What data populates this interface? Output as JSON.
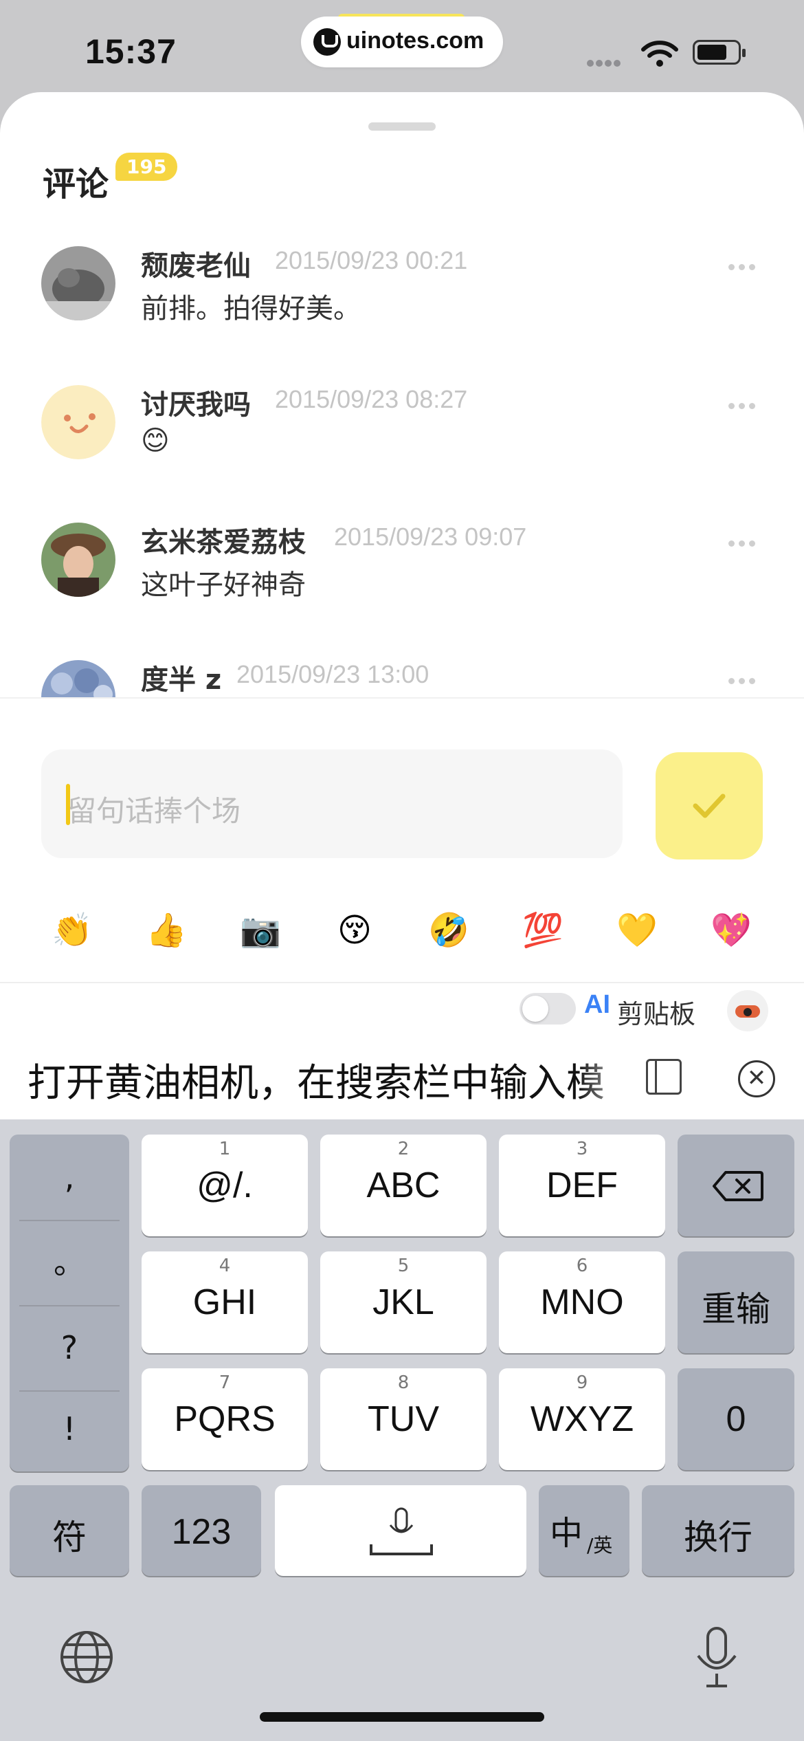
{
  "status_bar": {
    "time": "15:37",
    "url": "uinotes.com"
  },
  "comments_header": {
    "title": "评论",
    "count": "195"
  },
  "comments": [
    {
      "name": "颓废老仙",
      "time": "2015/09/23 00:21",
      "text": "前排。拍得好美。"
    },
    {
      "name": "讨厌我吗",
      "time": "2015/09/23 08:27",
      "text": "😊"
    },
    {
      "name": "玄米茶爱荔枝",
      "time": "2015/09/23 09:07",
      "text": "这叶子好神奇"
    },
    {
      "name": "度半 z",
      "time": "2015/09/23 13:00",
      "text": ""
    }
  ],
  "input": {
    "placeholder": "留句话捧个场"
  },
  "emojis": [
    "👏",
    "👍",
    "📷",
    "😚",
    "🤣",
    "💯",
    "💛",
    "💖"
  ],
  "clipboard_bar": {
    "ai": "AI",
    "label": "剪贴板"
  },
  "suggestion": {
    "text": "打开黄油相机，在搜索栏中输入模"
  },
  "keyboard": {
    "punct": [
      ",",
      "。",
      "?",
      "!"
    ],
    "keys": [
      {
        "num": "1",
        "label": "@/."
      },
      {
        "num": "2",
        "label": "ABC"
      },
      {
        "num": "3",
        "label": "DEF"
      },
      {
        "num": "4",
        "label": "GHI"
      },
      {
        "num": "5",
        "label": "JKL"
      },
      {
        "num": "6",
        "label": "MNO"
      },
      {
        "num": "7",
        "label": "PQRS"
      },
      {
        "num": "8",
        "label": "TUV"
      },
      {
        "num": "9",
        "label": "WXYZ"
      }
    ],
    "retype": "重输",
    "zero": "0",
    "symbols": "符",
    "numbers": "123",
    "lang_main": "中",
    "lang_sub": "/英",
    "newline": "换行"
  },
  "colors": {
    "accent_yellow": "#f6d541",
    "send_bg": "#fbf08a",
    "ai_blue": "#3b82f6"
  }
}
